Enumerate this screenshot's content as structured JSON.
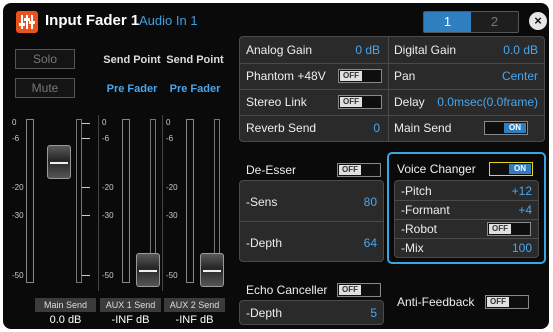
{
  "header": {
    "title": "Input Fader 1",
    "subtitle": "Audio In 1",
    "tabs": [
      "1",
      "2"
    ],
    "close_glyph": "×",
    "app_icon": "fader-icon"
  },
  "strip": {
    "solo_label": "Solo",
    "mute_label": "Mute",
    "send_point_header": "Send Point",
    "send_point_values": [
      "Pre Fader",
      "Pre Fader"
    ],
    "scale": [
      "0",
      "-6",
      "-20",
      "-30",
      "-50"
    ],
    "channels": [
      {
        "label": "Main Send",
        "value": "0.0 dB"
      },
      {
        "label": "AUX 1 Send",
        "value": "-INF dB"
      },
      {
        "label": "AUX 2 Send",
        "value": "-INF dB"
      }
    ]
  },
  "settings": {
    "analog_gain": {
      "label": "Analog Gain",
      "value": "0 dB"
    },
    "digital_gain": {
      "label": "Digital Gain",
      "value": "0.0 dB"
    },
    "phantom": {
      "label": "Phantom +48V",
      "state": "OFF"
    },
    "pan": {
      "label": "Pan",
      "value": "Center"
    },
    "stereo_link": {
      "label": "Stereo Link",
      "state": "OFF"
    },
    "delay": {
      "label": "Delay",
      "value": "0.0msec(0.0frame)"
    },
    "reverb_send": {
      "label": "Reverb Send",
      "value": "0"
    },
    "main_send": {
      "label": "Main Send",
      "state": "ON"
    }
  },
  "de_esser": {
    "label": "De-Esser",
    "state": "OFF",
    "sens": {
      "label": "-Sens",
      "value": "80"
    },
    "depth": {
      "label": "-Depth",
      "value": "64"
    }
  },
  "voice_changer": {
    "label": "Voice Changer",
    "state": "ON",
    "pitch": {
      "label": "-Pitch",
      "value": "+12"
    },
    "formant": {
      "label": "-Formant",
      "value": "+4"
    },
    "robot": {
      "label": "-Robot",
      "state": "OFF"
    },
    "mix": {
      "label": "-Mix",
      "value": "100"
    }
  },
  "echo_canceller": {
    "label": "Echo Canceller",
    "state": "OFF",
    "depth": {
      "label": "-Depth",
      "value": "5"
    }
  },
  "anti_feedback": {
    "label": "Anti-Feedback",
    "state": "OFF"
  },
  "colors": {
    "accent": "#2f7fc0",
    "value_blue": "#4aa6ec",
    "app_icon": "#e8541e",
    "selection": "#3aa8e0",
    "highlight_yellow": "#e6d21e"
  }
}
